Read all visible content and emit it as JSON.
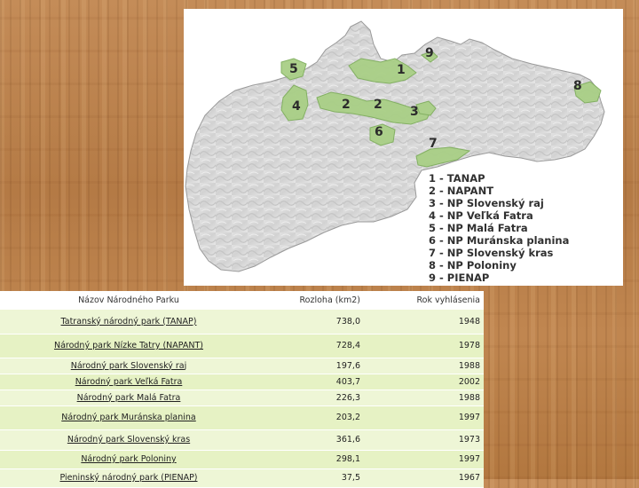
{
  "map": {
    "park_numbers": [
      "1",
      "2",
      "2",
      "3",
      "4",
      "5",
      "6",
      "7",
      "8",
      "9"
    ],
    "legend": [
      "1 - TANAP",
      "2 - NAPANT",
      "3 - NP Slovenský raj",
      "4 - NP Veľká Fatra",
      "5 - NP Malá Fatra",
      "6 - NP Muránska planina",
      "7 - NP Slovenský kras",
      "8 - NP Poloniny",
      "9 - PIENAP"
    ],
    "colors": {
      "land": "#dcdcdc",
      "park": "#a9cf86",
      "park_border": "#7fae5d"
    }
  },
  "table": {
    "headers": {
      "name": "Názov Národného Parku",
      "area": "Rozloha (km2)",
      "year": "Rok vyhlásenia"
    },
    "rows": [
      {
        "name": "Tatranský národný park (TANAP)",
        "area": "738,0",
        "year": "1948"
      },
      {
        "name": "Národný park Nízke Tatry (NAPANT)",
        "area": "728,4",
        "year": "1978"
      },
      {
        "name": "Národný park Slovenský raj",
        "area": "197,6",
        "year": "1988"
      },
      {
        "name": "Národný park Veľká Fatra",
        "area": "403,7",
        "year": "2002"
      },
      {
        "name": "Národný park Malá Fatra",
        "area": "226,3",
        "year": "1988"
      },
      {
        "name": "Národný park Muránska planina",
        "area": "203,2",
        "year": "1997"
      },
      {
        "name": "Národný park Slovenský kras",
        "area": "361,6",
        "year": "1973"
      },
      {
        "name": "Národný park Poloniny",
        "area": "298,1",
        "year": "1997"
      },
      {
        "name": "Pieninský národný park (PIENAP)",
        "area": "37,5",
        "year": "1967"
      }
    ],
    "row_colors": {
      "header": "#ffffff",
      "row": "#e6f2c4"
    }
  }
}
